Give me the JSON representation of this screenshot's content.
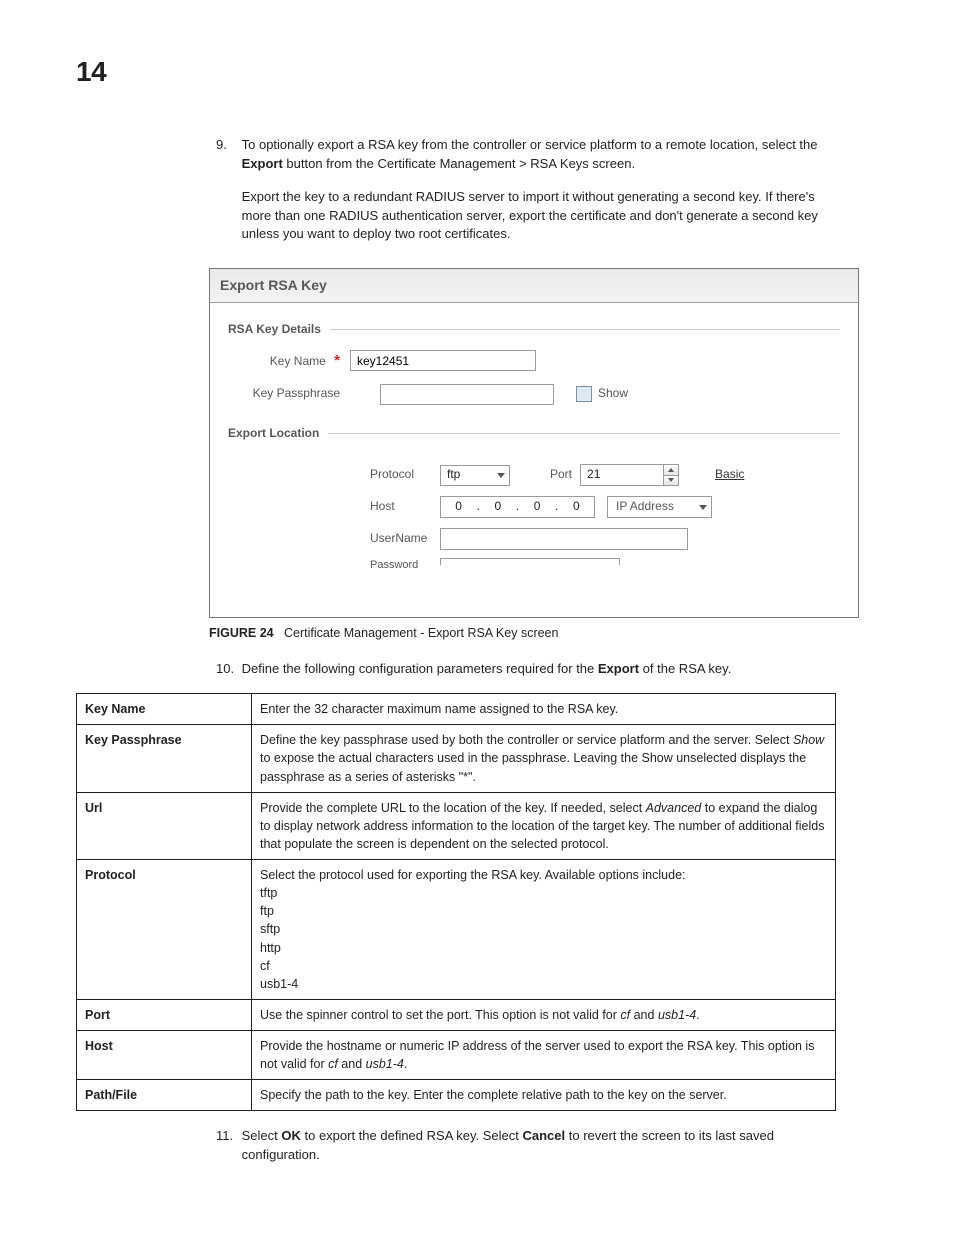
{
  "page_number": "14",
  "step9": {
    "num": "9.",
    "p1_a": "To optionally export a RSA key from the controller or service platform to a remote location, select the ",
    "p1_bold": "Export",
    "p1_b": " button from the Certificate Management > RSA Keys screen.",
    "p2": "Export the key to a redundant RADIUS server to import it without generating a second key. If there's more than one RADIUS authentication server, export the certificate and don't generate a second key unless you want to deploy two root certificates."
  },
  "figure": {
    "header": "Export RSA Key",
    "fs1_title": "RSA Key Details",
    "lbl_keyname": "Key Name",
    "val_keyname": "key12451",
    "lbl_passphrase": "Key Passphrase",
    "lbl_show_cb": "Show",
    "fs2_title": "Export Location",
    "lbl_protocol": "Protocol",
    "val_protocol": "ftp",
    "lbl_port": "Port",
    "val_port": "21",
    "link_basic": "Basic",
    "lbl_host": "Host",
    "ip_octets": [
      "0",
      "0",
      "0",
      "0"
    ],
    "val_addrtype": "IP Address",
    "lbl_username": "UserName",
    "lbl_password": "Password"
  },
  "caption": {
    "fig": "FIGURE 24",
    "text": "Certificate Management - Export RSA Key screen"
  },
  "step10": {
    "num": "10.",
    "p_a": "Define the following configuration parameters required for the ",
    "p_bold": "Export",
    "p_b": " of the RSA key."
  },
  "table": {
    "keyname": {
      "k": "Key Name",
      "v": "Enter the 32 character maximum name assigned to the RSA key."
    },
    "passphrase": {
      "k": "Key Passphrase",
      "v_a": "Define the key passphrase used by both the controller or service platform and the server. Select ",
      "v_i1": "Show",
      "v_b": " to expose the actual characters used in the passphrase. Leaving the Show unselected displays the passphrase as a series of asterisks \"*\"."
    },
    "url": {
      "k": "Url",
      "v_a": "Provide the complete URL to the location of the key. If needed, select ",
      "v_i1": "Advanced",
      "v_b": " to expand the dialog to display network address information to the location of the target key. The number of additional fields that populate the screen is dependent on the selected protocol."
    },
    "protocol": {
      "k": "Protocol",
      "v_intro": "Select the protocol used for exporting the RSA key. Available options include:",
      "opts": [
        "tftp",
        "ftp",
        "sftp",
        "http",
        "cf",
        "usb1-4"
      ]
    },
    "port": {
      "k": "Port",
      "v_a": "Use the spinner control to set the port. This option is not valid for ",
      "v_i1": "cf",
      "v_mid": " and ",
      "v_i2": "usb1-4",
      "v_b": "."
    },
    "host": {
      "k": "Host",
      "v_a": "Provide the hostname or numeric IP address of the server used to export the RSA key. This option is not valid for ",
      "v_i1": "cf",
      "v_mid": " and ",
      "v_i2": "usb1-4",
      "v_b": "."
    },
    "path": {
      "k": "Path/File",
      "v": "Specify the path to the key. Enter the complete relative path to the key on the server."
    }
  },
  "step11": {
    "num": "11.",
    "p_a": "Select ",
    "p_b1": "OK",
    "p_mid": " to export the defined RSA key. Select ",
    "p_b2": "Cancel",
    "p_end": " to revert the screen to its last saved configuration."
  }
}
